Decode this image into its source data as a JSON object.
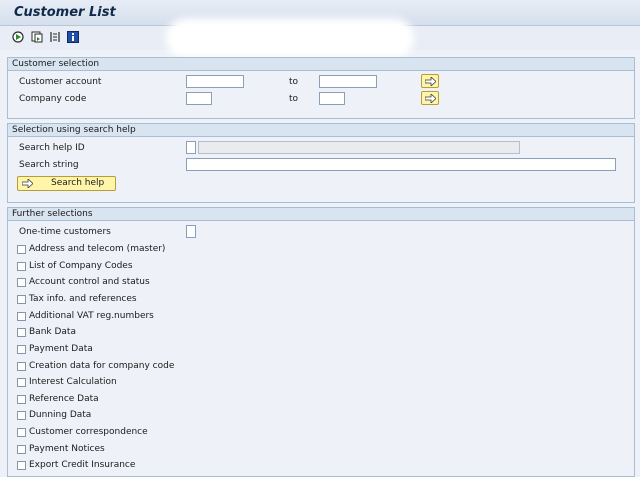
{
  "window": {
    "title": "Customer List"
  },
  "toolbar": {
    "icons": [
      "execute-icon",
      "variant-icon",
      "selection-options-icon",
      "info-icon"
    ]
  },
  "customer_selection": {
    "header": "Customer selection",
    "rows": [
      {
        "label": "Customer account",
        "to_label": "to",
        "from_value": "",
        "to_value": ""
      },
      {
        "label": "Company code",
        "to_label": "to",
        "from_value": "",
        "to_value": ""
      }
    ]
  },
  "search_help": {
    "header": "Selection using search help",
    "id_label": "Search help ID",
    "string_label": "Search string",
    "button_label": "Search help"
  },
  "further": {
    "header": "Further selections",
    "one_time_label": "One-time customers",
    "checkboxes": [
      "Address and telecom (master)",
      "List of Company Codes",
      "Account control and status",
      "Tax info. and references",
      "Additional VAT reg.numbers",
      "Bank Data",
      "Payment Data",
      "Creation data for company code",
      "Interest Calculation",
      "Reference Data",
      "Dunning Data",
      "Customer correspondence",
      "Payment Notices",
      "Export Credit Insurance"
    ]
  },
  "colors": {
    "background": "#eef2f8",
    "group_header": "#d9e4f1",
    "button_yellow": "#fff5a8",
    "title_text": "#0f2a4a"
  }
}
